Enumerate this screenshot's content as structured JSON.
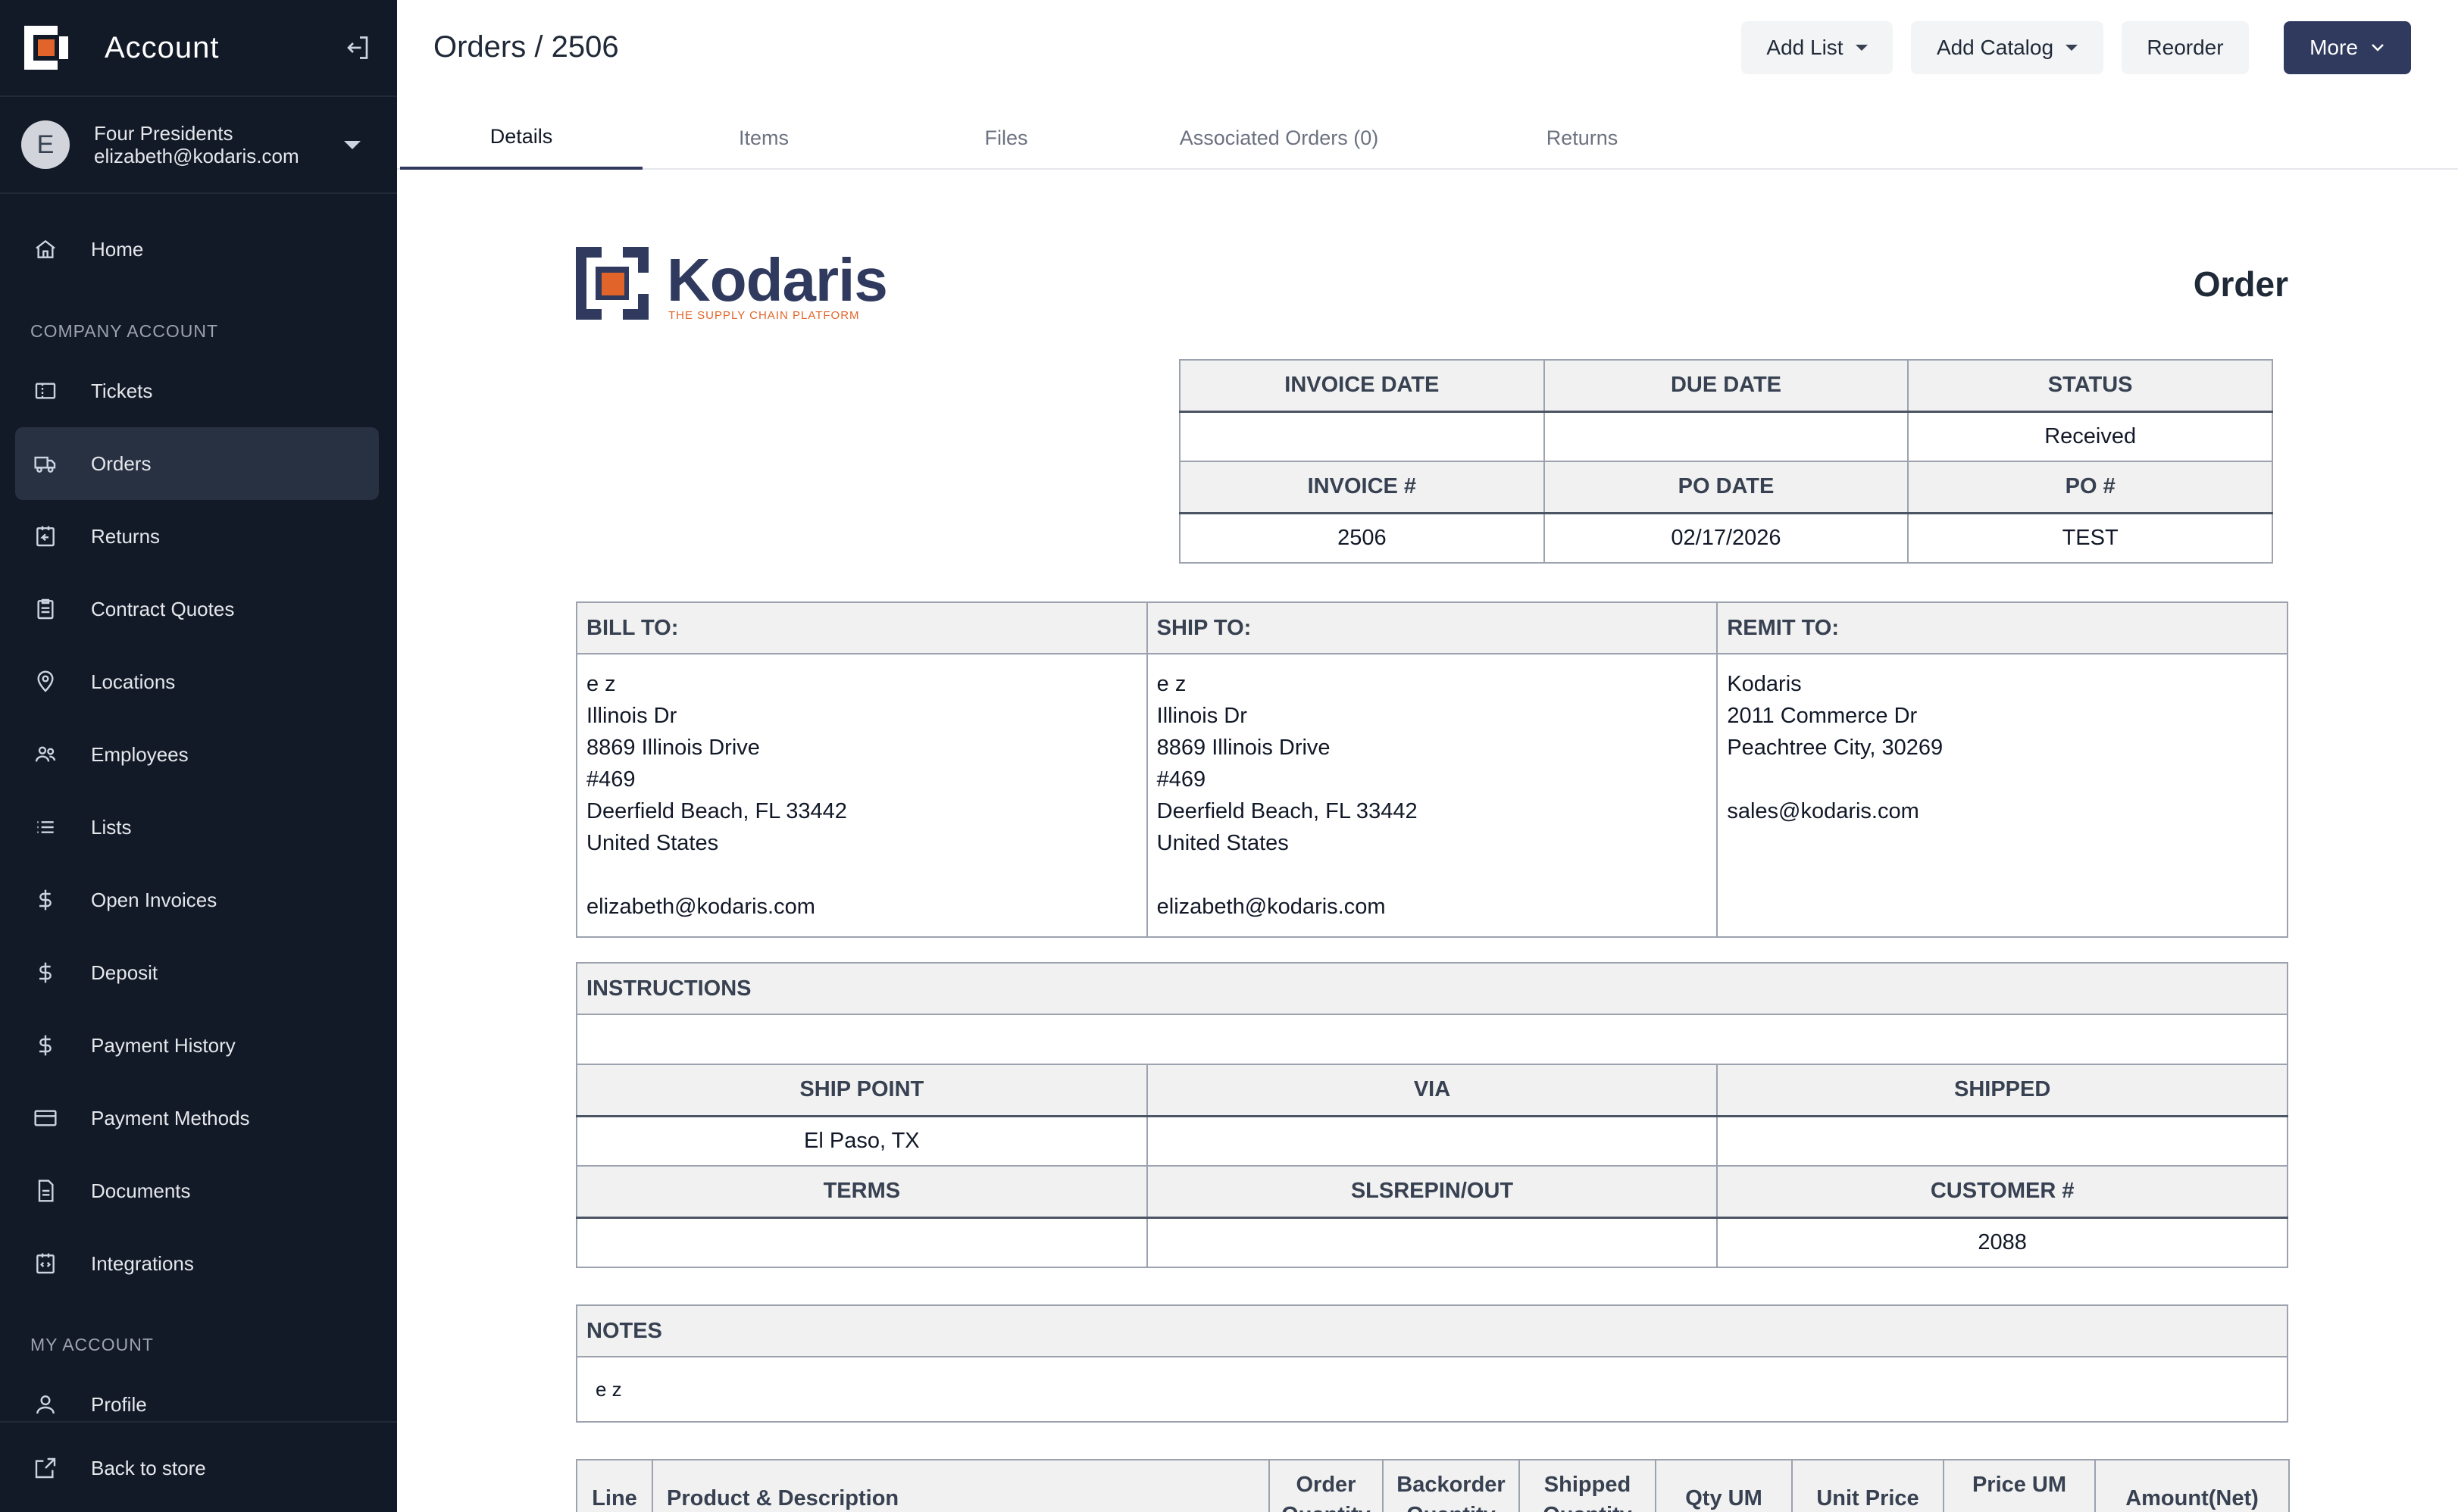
{
  "sidebar": {
    "title": "Account",
    "user": {
      "initial": "E",
      "name": "Four Presidents",
      "email": "elizabeth@kodaris.com"
    },
    "sections": {
      "company": "COMPANY ACCOUNT",
      "my": "MY ACCOUNT"
    },
    "items": [
      {
        "label": "Home",
        "icon": "home-icon"
      },
      {
        "label": "Tickets",
        "icon": "ticket-icon"
      },
      {
        "label": "Orders",
        "icon": "truck-icon"
      },
      {
        "label": "Returns",
        "icon": "return-icon"
      },
      {
        "label": "Contract Quotes",
        "icon": "clipboard-icon"
      },
      {
        "label": "Locations",
        "icon": "location-pin-icon"
      },
      {
        "label": "Employees",
        "icon": "users-icon"
      },
      {
        "label": "Lists",
        "icon": "list-icon"
      },
      {
        "label": "Open Invoices",
        "icon": "dollar-icon"
      },
      {
        "label": "Deposit",
        "icon": "dollar-icon"
      },
      {
        "label": "Payment History",
        "icon": "dollar-icon"
      },
      {
        "label": "Payment Methods",
        "icon": "credit-card-icon"
      },
      {
        "label": "Documents",
        "icon": "document-icon"
      },
      {
        "label": "Integrations",
        "icon": "integration-icon"
      },
      {
        "label": "Profile",
        "icon": "user-icon"
      }
    ],
    "back": "Back to store"
  },
  "header": {
    "breadcrumb": "Orders / 2506",
    "buttons": {
      "add_list": "Add List",
      "add_catalog": "Add Catalog",
      "reorder": "Reorder",
      "more": "More"
    },
    "tabs": [
      "Details",
      "Items",
      "Files",
      "Associated Orders (0)",
      "Returns"
    ]
  },
  "doc": {
    "brand": {
      "name": "Kodaris",
      "tagline": "THE SUPPLY CHAIN PLATFORM"
    },
    "title": "Order",
    "summary": {
      "h1": [
        "INVOICE DATE",
        "DUE DATE",
        "STATUS"
      ],
      "r1": [
        "",
        "",
        "Received"
      ],
      "h2": [
        "INVOICE #",
        "PO DATE",
        "PO #"
      ],
      "r2": [
        "2506",
        "02/17/2026",
        "TEST"
      ]
    },
    "address": {
      "bill_label": "BILL TO:",
      "ship_label": "SHIP TO:",
      "remit_label": "REMIT TO:",
      "bill": [
        "e z",
        "Illinois Dr",
        "8869 Illinois Drive",
        "#469",
        "Deerfield Beach, FL 33442",
        "United States",
        "",
        "elizabeth@kodaris.com"
      ],
      "ship": [
        "e z",
        "Illinois Dr",
        "8869 Illinois Drive",
        "#469",
        "Deerfield Beach, FL 33442",
        "United States",
        "",
        "elizabeth@kodaris.com"
      ],
      "remit": [
        "Kodaris",
        "2011 Commerce Dr",
        "Peachtree City, 30269",
        "",
        "sales@kodaris.com"
      ]
    },
    "instructions": {
      "label": "INSTRUCTIONS",
      "value": ""
    },
    "shipping": {
      "h1": [
        "SHIP POINT",
        "VIA",
        "SHIPPED"
      ],
      "r1": [
        "El Paso, TX",
        "",
        ""
      ],
      "h2": [
        "TERMS",
        "SLSREPIN/OUT",
        "CUSTOMER #"
      ],
      "r2": [
        "",
        "",
        "2088"
      ]
    },
    "notes": {
      "label": "NOTES",
      "value": "e z"
    },
    "lines_headers": [
      "Line",
      "Product & Description",
      "Order Quantity",
      "Backorder Quantity",
      "Shipped Quantity",
      "Qty UM",
      "Unit Price",
      "Price UM",
      "Amount(Net)"
    ]
  },
  "colors": {
    "sidebar_bg": "#121927",
    "primary": "#2f3a5e",
    "brand_orange": "#e1652a"
  }
}
